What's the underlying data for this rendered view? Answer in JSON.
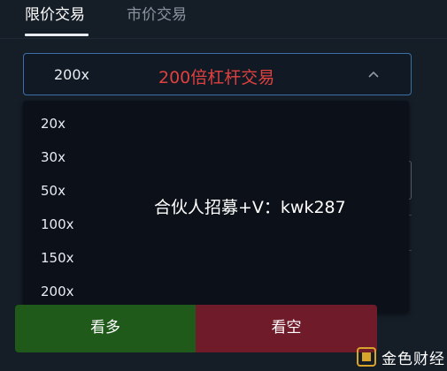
{
  "tabs": [
    {
      "label": "限价交易",
      "active": true
    },
    {
      "label": "市价交易",
      "active": false
    }
  ],
  "leverage_select": {
    "value": "200x",
    "hint": "200倍杠杆交易",
    "options": [
      "20x",
      "30x",
      "50x",
      "100x",
      "150x",
      "200x"
    ]
  },
  "overlay": {
    "text": "合伙人招募+V：kwk287"
  },
  "buttons": {
    "long_label": "看多",
    "short_label": "看空"
  },
  "watermark": {
    "brand": "金色财经"
  },
  "colors": {
    "background": "#151d27",
    "select_border": "#3c6fa8",
    "hint_red": "#e0403e",
    "long_green": "#1f5a1b",
    "short_red": "#701b2a",
    "watermark_gold": "#d9a42a"
  }
}
